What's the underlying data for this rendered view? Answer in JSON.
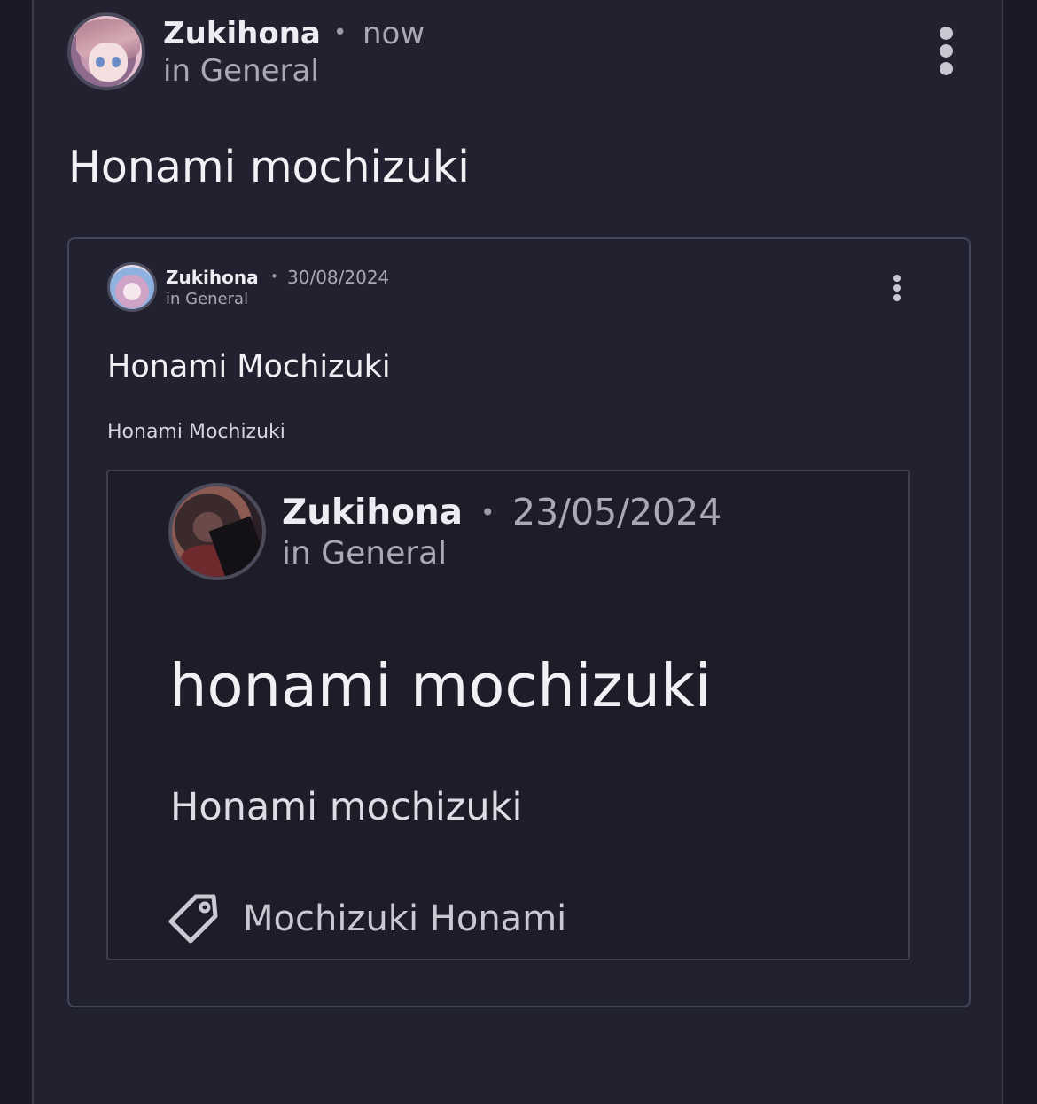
{
  "post": {
    "author": "Zukihona",
    "separator": "•",
    "time": "now",
    "category": "in General",
    "title": "Honami mochizuki"
  },
  "embed1": {
    "author": "Zukihona",
    "separator": "•",
    "date": "30/08/2024",
    "category": "in General",
    "title": "Honami Mochizuki",
    "body": "Honami Mochizuki"
  },
  "embed2": {
    "author": "Zukihona",
    "separator": "•",
    "date": "23/05/2024",
    "category": "in General",
    "title": "honami mochizuki",
    "body": "Honami mochizuki",
    "tag": "Mochizuki Honami",
    "tag_icon": "tag-icon"
  },
  "icons": {
    "menu": "more-vertical-icon",
    "avatar": "avatar"
  }
}
